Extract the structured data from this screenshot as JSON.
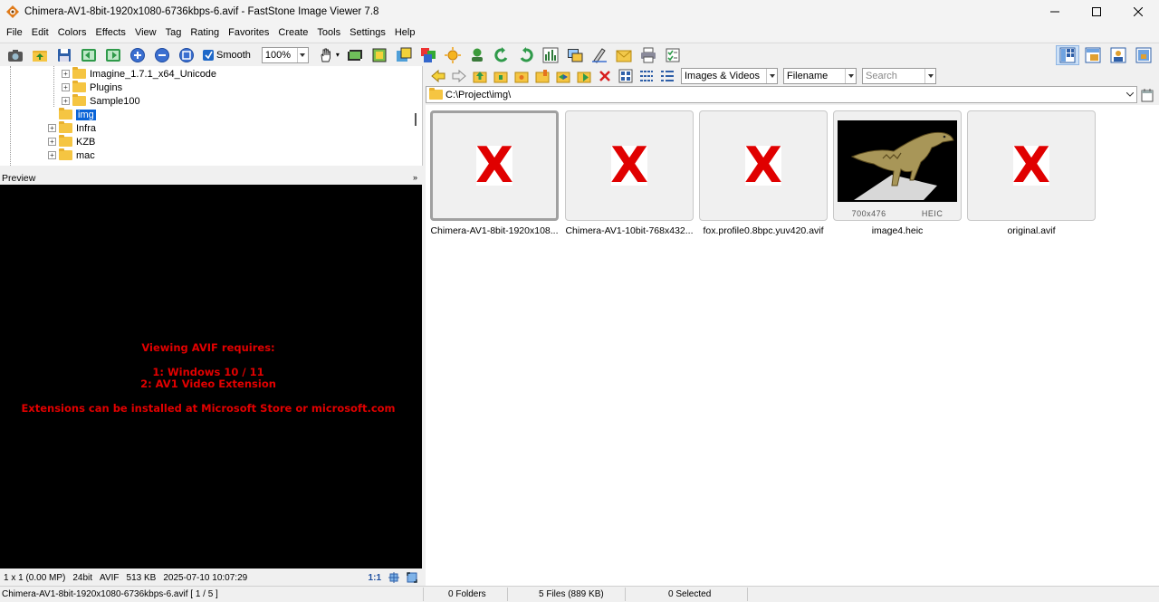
{
  "window": {
    "title": "Chimera-AV1-8bit-1920x1080-6736kbps-6.avif  -  FastStone Image Viewer 7.8"
  },
  "menu": [
    "File",
    "Edit",
    "Colors",
    "Effects",
    "View",
    "Tag",
    "Rating",
    "Favorites",
    "Create",
    "Tools",
    "Settings",
    "Help"
  ],
  "toolbar": {
    "smooth_label": "Smooth",
    "zoom_value": "100%"
  },
  "tree": {
    "items": [
      {
        "label": "Imagine_1.7.1_x64_Unicode",
        "level": 2,
        "expandable": true
      },
      {
        "label": "Plugins",
        "level": 2,
        "expandable": true
      },
      {
        "label": "Sample100",
        "level": 2,
        "expandable": true
      },
      {
        "label": "img",
        "level": 1,
        "expandable": false,
        "selected": true
      },
      {
        "label": "Infra",
        "level": 1,
        "expandable": true
      },
      {
        "label": "KZB",
        "level": 1,
        "expandable": true
      },
      {
        "label": "mac",
        "level": 1,
        "expandable": true
      }
    ]
  },
  "preview": {
    "header": "Preview",
    "message_lines": [
      "Viewing AVIF requires:",
      "1: Windows 10 / 11",
      "2: AV1 Video Extension",
      "Extensions can be installed at Microsoft Store or microsoft.com"
    ],
    "info": {
      "dimensions": "1 x 1 (0.00 MP)",
      "depth": "24bit",
      "format": "AVIF",
      "size": "513 KB",
      "date": "2025-07-10 10:07:29",
      "ratio": "1:1"
    }
  },
  "browser": {
    "filter": "Images & Videos",
    "sort": "Filename",
    "search_placeholder": "Search",
    "path": "C:\\Project\\img\\"
  },
  "thumbnails": [
    {
      "caption": "Chimera-AV1-8bit-1920x108...",
      "broken": true,
      "selected": true
    },
    {
      "caption": "Chimera-AV1-10bit-768x432...",
      "broken": true,
      "selected": false
    },
    {
      "caption": "fox.profile0.8bpc.yuv420.avif",
      "broken": true,
      "selected": false
    },
    {
      "caption": "image4.heic",
      "broken": false,
      "selected": false,
      "dims": "700x476",
      "format": "HEIC"
    },
    {
      "caption": "original.avif",
      "broken": true,
      "selected": false
    }
  ],
  "broken_mark": "X",
  "status": {
    "file": "Chimera-AV1-8bit-1920x1080-6736kbps-6.avif [ 1 / 5 ]",
    "folders": "0 Folders",
    "files": "5 Files (889 KB)",
    "selected": "0 Selected"
  },
  "colors": {
    "accent": "#0a64d7",
    "error": "#e10000"
  }
}
